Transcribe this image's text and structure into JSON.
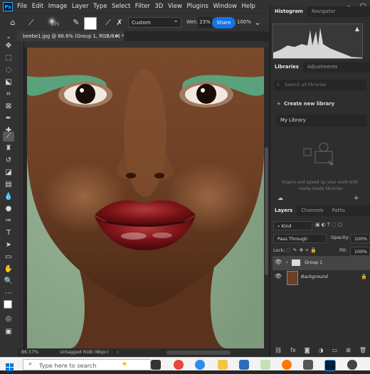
{
  "app": {
    "logo": "Ps"
  },
  "menu": [
    "File",
    "Edit",
    "Image",
    "Layer",
    "Type",
    "Select",
    "Filter",
    "3D",
    "View",
    "Plugins",
    "Window",
    "Help"
  ],
  "window_controls": {
    "minimize": "–",
    "maximize": "▢"
  },
  "options_bar": {
    "brush_size": "175",
    "mode": "Custom",
    "wet_label": "Wet:",
    "wet_value": "23%",
    "share_label": "Share",
    "zoom_value": "100%"
  },
  "document_tab": {
    "title": "beebe1.jpg @ 86.6% (Group 1, RGB/8#) *",
    "close": "×"
  },
  "status_bar": {
    "zoom": "86.57%",
    "profile": "Untagged RGB (8bpc)"
  },
  "panels": {
    "histogram_tabs": [
      "Histogram",
      "Navigator"
    ],
    "libraries_tabs": [
      "Libraries",
      "Adjustments"
    ],
    "libraries": {
      "search_placeholder": "Search all libraries",
      "create_label": "Create new library",
      "my_library": "My Library",
      "empty_text_line1": "Inspire and speed up your work with",
      "empty_text_line2": "ready-made libraries."
    },
    "layers_tabs": [
      "Layers",
      "Channels",
      "Paths"
    ],
    "layers": {
      "filter_kind": "Kind",
      "blend_mode": "Pass Through",
      "opacity_label": "Opacity:",
      "opacity_value": "100%",
      "lock_label": "Lock:",
      "fill_label": "Fill:",
      "fill_value": "100%",
      "items": [
        {
          "name": "Group 1",
          "selected": true
        },
        {
          "name": "Background",
          "selected": false
        }
      ]
    }
  },
  "taskbar": {
    "search_placeholder": "Type here to search"
  },
  "colors": {
    "accent": "#1473e6",
    "background_green": "#8da88c",
    "lip_red": "#7a1216"
  }
}
